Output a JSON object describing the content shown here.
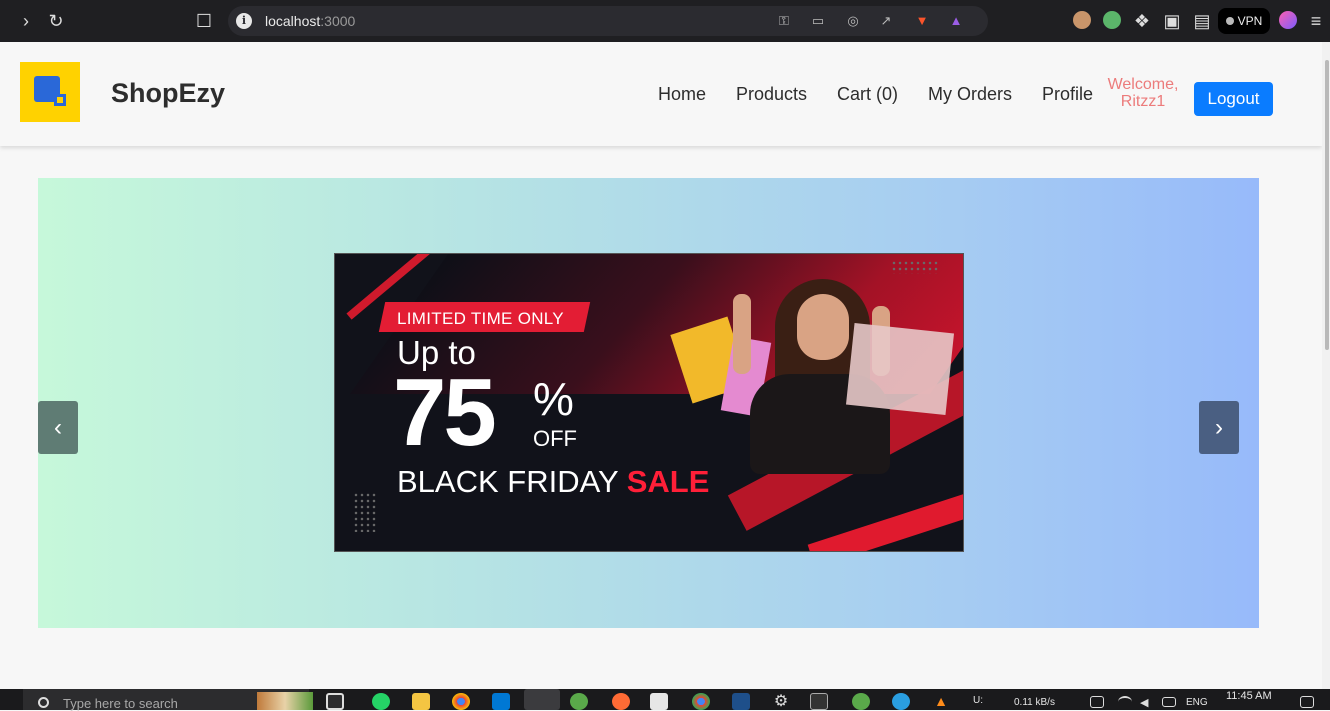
{
  "browser": {
    "url_host": "localhost",
    "url_port": ":3000",
    "vpn_label": "VPN"
  },
  "app": {
    "brand": "ShopEzy",
    "nav": [
      "Home",
      "Products",
      "Cart (0)",
      "My Orders",
      "Profile"
    ],
    "welcome_line1": "Welcome,",
    "welcome_line2": "Ritzz1",
    "logout_label": "Logout"
  },
  "carousel": {
    "prev_label": "‹",
    "next_label": "›",
    "banner": {
      "tag": "LIMITED TIME ONLY",
      "upto": "Up to",
      "discount": "75",
      "percent": "%",
      "off": "OFF",
      "event": "BLACK FRIDAY",
      "sale": "SALE"
    }
  },
  "taskbar": {
    "search_placeholder": "Type here to search",
    "net_label": "U:",
    "net_speed": "0.11 kB/s",
    "lang": "ENG",
    "time": "11:45 AM"
  }
}
